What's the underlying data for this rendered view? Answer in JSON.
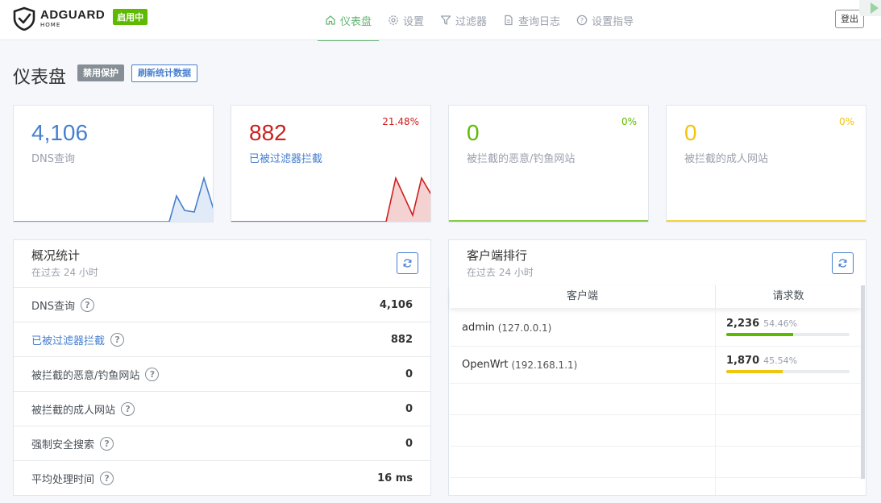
{
  "header": {
    "logo_name": "ADGUARD",
    "logo_sub": "HOME",
    "status_badge": "启用中",
    "nav": [
      {
        "label": "仪表盘",
        "icon": "home-icon",
        "active": true
      },
      {
        "label": "设置",
        "icon": "gear-icon",
        "active": false
      },
      {
        "label": "过滤器",
        "icon": "filter-icon",
        "active": false
      },
      {
        "label": "查询日志",
        "icon": "document-icon",
        "active": false
      },
      {
        "label": "设置指导",
        "icon": "help-circle-icon",
        "active": false
      }
    ],
    "logout_label": "登出"
  },
  "page": {
    "title": "仪表盘",
    "disable_protection": "禁用保护",
    "refresh_stats": "刷新统计数据"
  },
  "cards": [
    {
      "value": "4,106",
      "label": "DNS查询",
      "percent": "",
      "color": "#467fcf"
    },
    {
      "value": "882",
      "label": "已被过滤器拦截",
      "percent": "21.48%",
      "color": "#cd201f"
    },
    {
      "value": "0",
      "label": "被拦截的恶意/钓鱼网站",
      "percent": "0%",
      "color": "#5eba00"
    },
    {
      "value": "0",
      "label": "被拦截的成人网站",
      "percent": "0%",
      "color": "#f1c40f"
    }
  ],
  "general": {
    "title": "概况统计",
    "subtitle": "在过去 24 小时",
    "rows": [
      {
        "label": "DNS查询",
        "value": "4,106"
      },
      {
        "label": "已被过滤器拦截",
        "value": "882"
      },
      {
        "label": "被拦截的恶意/钓鱼网站",
        "value": "0"
      },
      {
        "label": "被拦截的成人网站",
        "value": "0"
      },
      {
        "label": "强制安全搜索",
        "value": "0"
      },
      {
        "label": "平均处理时间",
        "value": "16 ms"
      }
    ]
  },
  "clients": {
    "title": "客户端排行",
    "subtitle": "在过去 24 小时",
    "col_client": "客户端",
    "col_requests": "请求数",
    "rows": [
      {
        "name": "admin",
        "ip": "(127.0.0.1)",
        "count": "2,236",
        "percent": "54.46%",
        "fraction": 0.5446,
        "color": "#5eba00"
      },
      {
        "name": "OpenWrt",
        "ip": "(192.168.1.1)",
        "count": "1,870",
        "percent": "45.54%",
        "fraction": 0.4554,
        "color": "#f1c40f"
      }
    ]
  }
}
